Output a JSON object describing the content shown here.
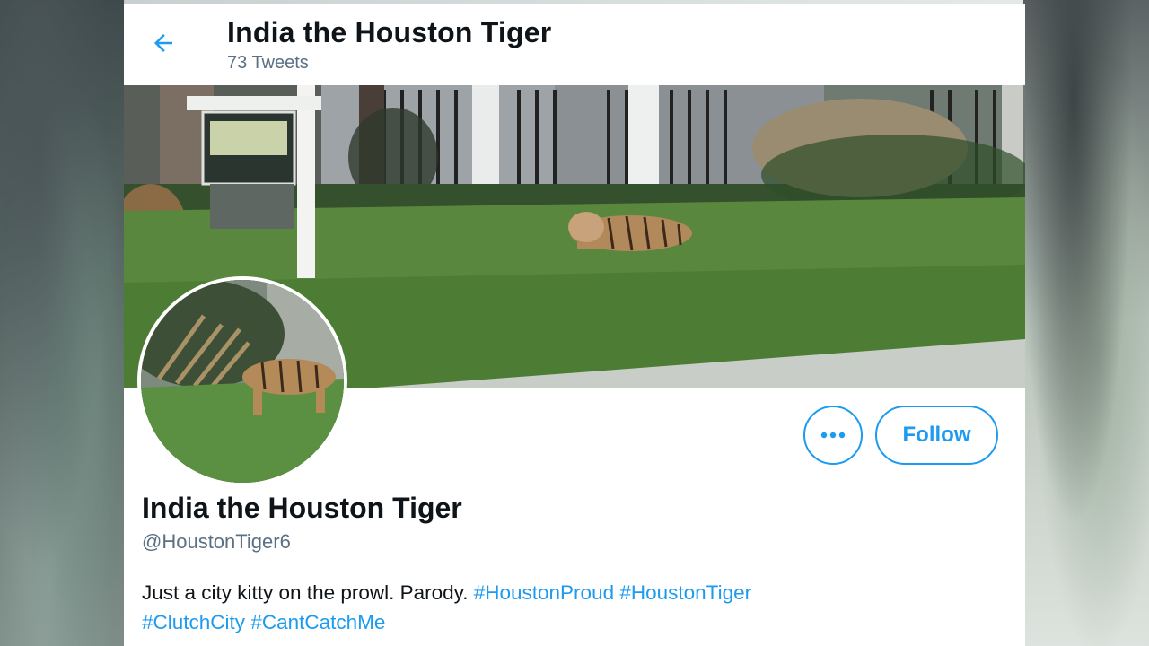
{
  "header": {
    "back_icon": "arrow-left-icon",
    "title": "India the Houston Tiger",
    "tweet_count": "73 Tweets"
  },
  "banner": {
    "description_icon": "banner-photo"
  },
  "actions": {
    "more_icon": "more-horizontal-icon",
    "follow_label": "Follow"
  },
  "profile": {
    "display_name": "India the Houston Tiger",
    "handle": "@HoustonTiger6",
    "bio_text": "Just a city kitty on the prowl. Parody. ",
    "hashtags": [
      "#HoustonProud",
      "#HoustonTiger",
      "#ClutchCity",
      "#CantCatchMe"
    ]
  },
  "colors": {
    "accent": "#1d9bf0",
    "text_primary": "#0f1419",
    "text_secondary": "#5b7083"
  }
}
